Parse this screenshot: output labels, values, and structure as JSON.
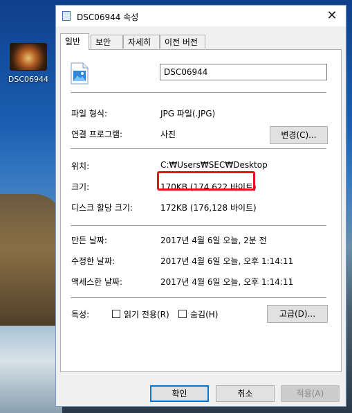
{
  "desktop": {
    "icon_label": "DSC06944"
  },
  "window": {
    "title": "DSC06944 속성",
    "close_glyph": "✕"
  },
  "tabs": [
    {
      "label": "일반"
    },
    {
      "label": "보안"
    },
    {
      "label": "자세히"
    },
    {
      "label": "이전 버전"
    }
  ],
  "general": {
    "file_name": "DSC06944",
    "file_type_label": "파일 형식:",
    "file_type_value": "JPG 파일(.JPG)",
    "opens_with_label": "연결 프로그램:",
    "opens_with_value": "사진",
    "change_button": "변경(C)...",
    "location_label": "위치:",
    "location_value": "C:₩Users₩SEC₩Desktop",
    "size_label": "크기:",
    "size_value": "170KB (174,622 바이트)",
    "size_on_disk_label": "디스크 할당 크기:",
    "size_on_disk_value": "172KB (176,128 바이트)",
    "created_label": "만든 날짜:",
    "created_value": "2017년 4월 6일 오늘, 2분 전",
    "modified_label": "수정한 날짜:",
    "modified_value": "2017년 4월 6일 오늘, 오후 1:14:11",
    "accessed_label": "액세스한 날짜:",
    "accessed_value": "2017년 4월 6일 오늘, 오후 1:14:11",
    "attributes_label": "특성:",
    "readonly_label": "읽기 전용(R)",
    "hidden_label": "숨김(H)",
    "advanced_button": "고급(D)..."
  },
  "footer": {
    "ok": "확인",
    "cancel": "취소",
    "apply": "적용(A)"
  },
  "colors": {
    "highlight": "#e3141b",
    "accent": "#0078d7"
  }
}
